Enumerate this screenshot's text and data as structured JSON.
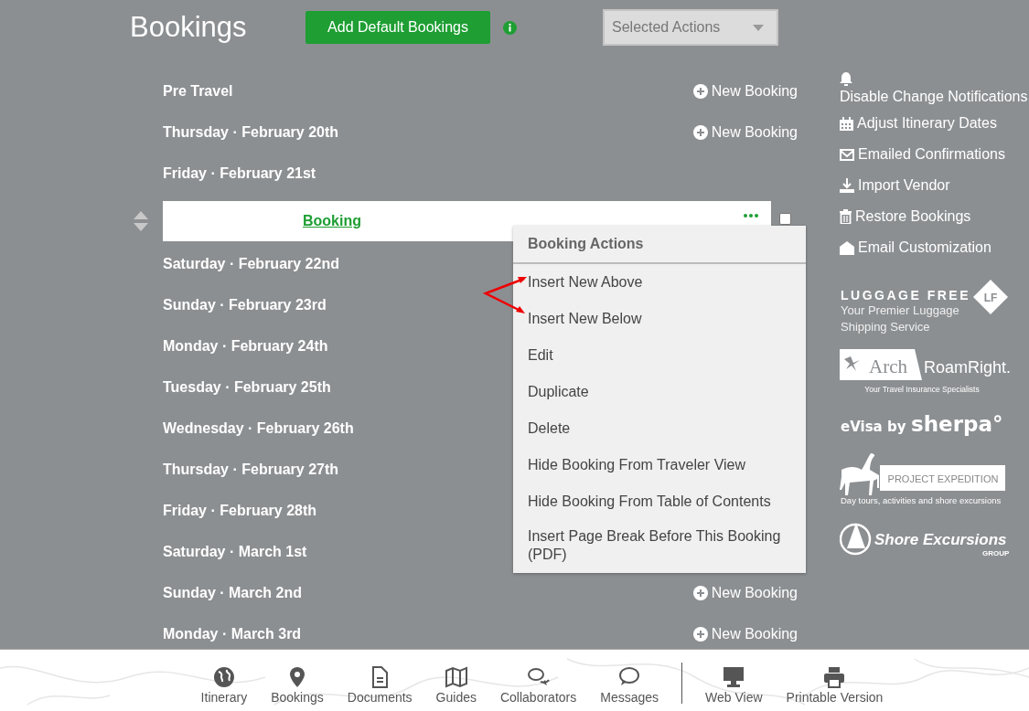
{
  "page_title": "Bookings",
  "add_button": "Add Default Bookings",
  "selected_actions": {
    "placeholder": "Selected Actions"
  },
  "days": [
    {
      "label": "Pre Travel",
      "new_booking": "New Booking"
    },
    {
      "label": "Thursday · February 20th",
      "new_booking": "New Booking"
    },
    {
      "label": "Friday · February 21st",
      "bookings": [
        {
          "title": "Booking",
          "checked": false
        }
      ]
    },
    {
      "label": "Saturday · February 22nd"
    },
    {
      "label": "Sunday · February 23rd"
    },
    {
      "label": "Monday · February 24th"
    },
    {
      "label": "Tuesday · February 25th"
    },
    {
      "label": "Wednesday · February 26th"
    },
    {
      "label": "Thursday · February 27th"
    },
    {
      "label": "Friday · February 28th"
    },
    {
      "label": "Saturday · March 1st"
    },
    {
      "label": "Sunday · March 2nd",
      "new_booking": "New Booking"
    },
    {
      "label": "Monday · March 3rd",
      "new_booking": "New Booking"
    }
  ],
  "menu": {
    "title": "Booking Actions",
    "items": [
      "Insert New Above",
      "Insert New Below",
      "Edit",
      "Duplicate",
      "Delete",
      "Hide Booking From Traveler View",
      "Hide Booking From Table of Contents",
      "Insert Page Break Before This Booking (PDF)"
    ]
  },
  "sidebar_actions": [
    "Disable Change Notifications",
    "Adjust Itinerary Dates",
    "Emailed Confirmations",
    "Import Vendor",
    "Restore Bookings",
    "Email Customization"
  ],
  "partners": [
    {
      "kind": "luggage",
      "name": "LUGGAGE FREE",
      "badge": "LF",
      "tagline": "Your Premier Luggage Shipping Service"
    },
    {
      "kind": "roamright",
      "name": "Arch",
      "name2": "RoamRight.",
      "tagline": "Your Travel Insurance Specialists"
    },
    {
      "kind": "sherpa",
      "name": "eVisa by",
      "name2": "sherpa°"
    },
    {
      "kind": "expedition",
      "name": "PROJECT EXPEDITION",
      "tagline": "Day tours, activities and shore excursions"
    },
    {
      "kind": "shore",
      "name": "Shore Excursions",
      "tagline": "GROUP"
    }
  ],
  "nav": [
    "Itinerary",
    "Bookings",
    "Documents",
    "Guides",
    "Collaborators",
    "Messages"
  ],
  "view_nav": [
    "Web View",
    "Printable Version"
  ]
}
